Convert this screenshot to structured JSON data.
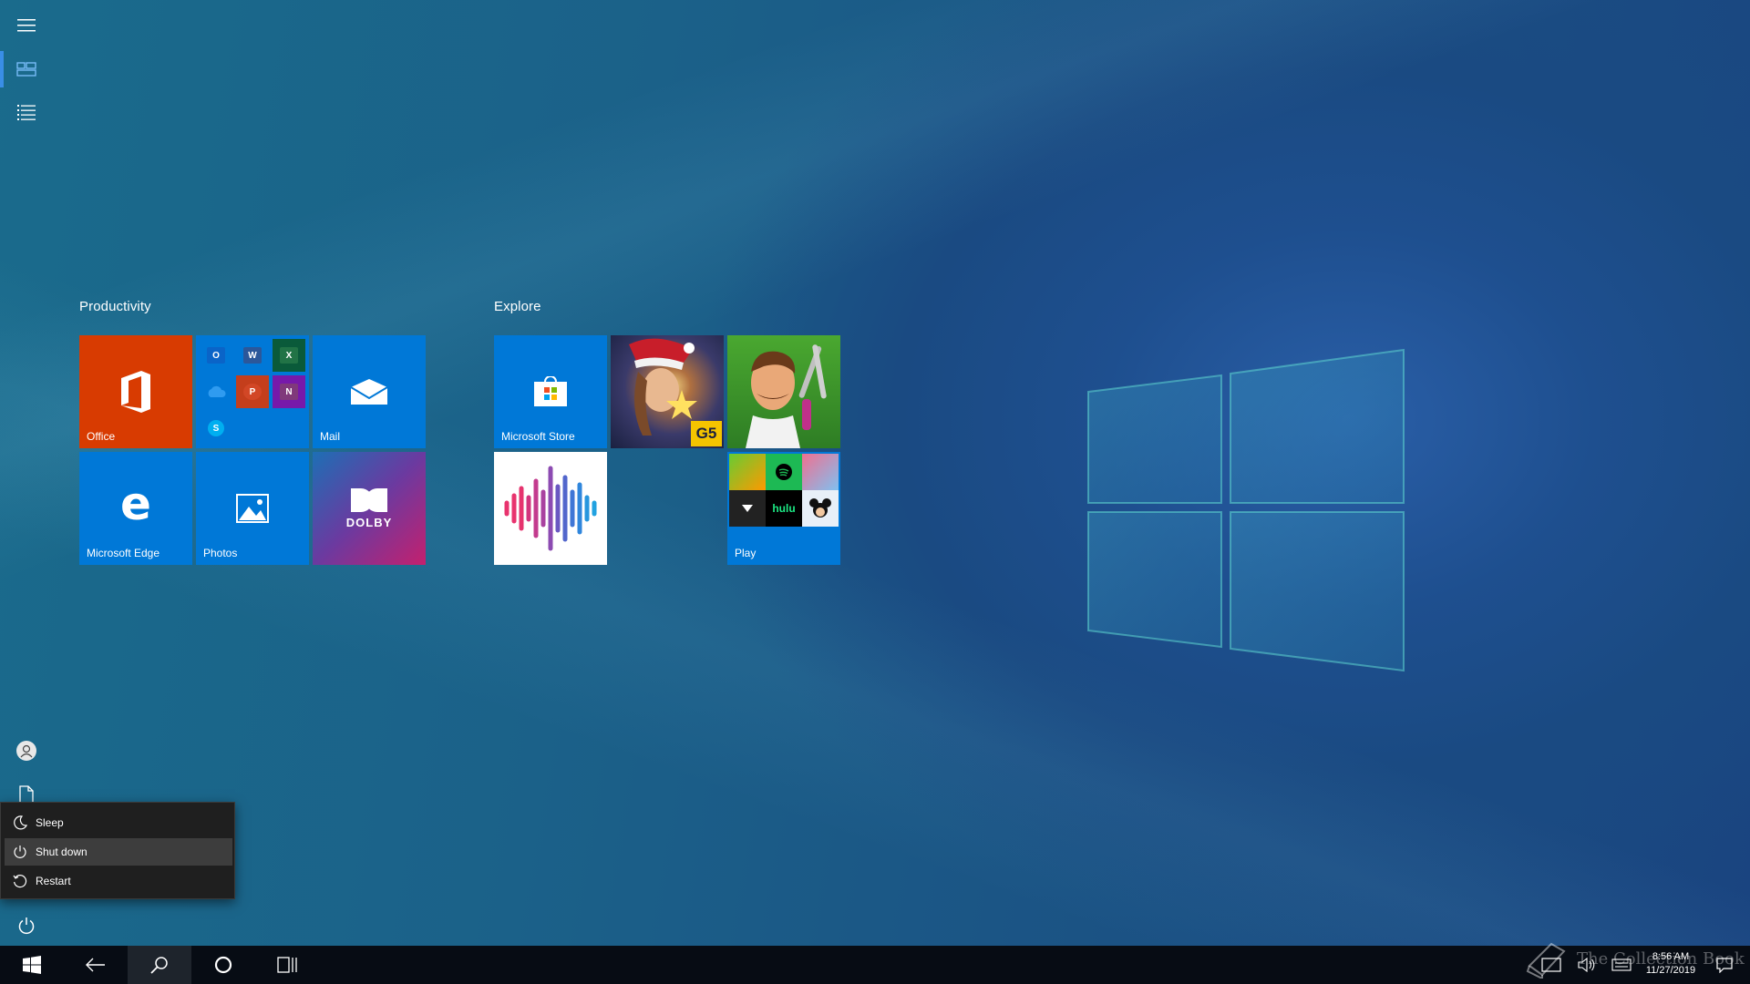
{
  "start": {
    "groups": [
      {
        "title": "Productivity",
        "tiles": [
          {
            "label": "Office",
            "bg": "#d83b01"
          },
          {
            "label": "",
            "bg": "#0078d7"
          },
          {
            "label": "Mail",
            "bg": "#0078d7"
          },
          {
            "label": "Microsoft Edge",
            "bg": "#0078d7"
          },
          {
            "label": "Photos",
            "bg": "#0078d7"
          },
          {
            "label": "DOLBY",
            "bg": "#7b2d8a"
          }
        ]
      },
      {
        "title": "Explore",
        "tiles": [
          {
            "label": "Microsoft Store",
            "bg": "#0078d7"
          },
          {
            "label": "",
            "bg": "#1a2a4a"
          },
          {
            "label": "",
            "bg": "#3a7a2a"
          },
          {
            "label": "",
            "bg": "#ffffff"
          },
          {
            "label": "Play",
            "bg": "#0078d7"
          }
        ]
      }
    ],
    "folder_apps": [
      "O",
      "W",
      "X",
      "",
      "P",
      "N",
      "S"
    ],
    "play_apps": [
      "hulu"
    ],
    "game_badge": "G5"
  },
  "power_menu": {
    "items": [
      {
        "label": "Sleep",
        "icon": "moon-icon"
      },
      {
        "label": "Shut down",
        "icon": "power-icon"
      },
      {
        "label": "Restart",
        "icon": "restart-icon"
      }
    ]
  },
  "taskbar": {
    "time": "8:56 AM",
    "date": "11/27/2019"
  },
  "watermark": "The Collection Book",
  "colors": {
    "accent": "#0078d7",
    "office": "#d83b01",
    "menu_bg": "#1f1f1f",
    "taskbar_bg": "#070c14"
  }
}
